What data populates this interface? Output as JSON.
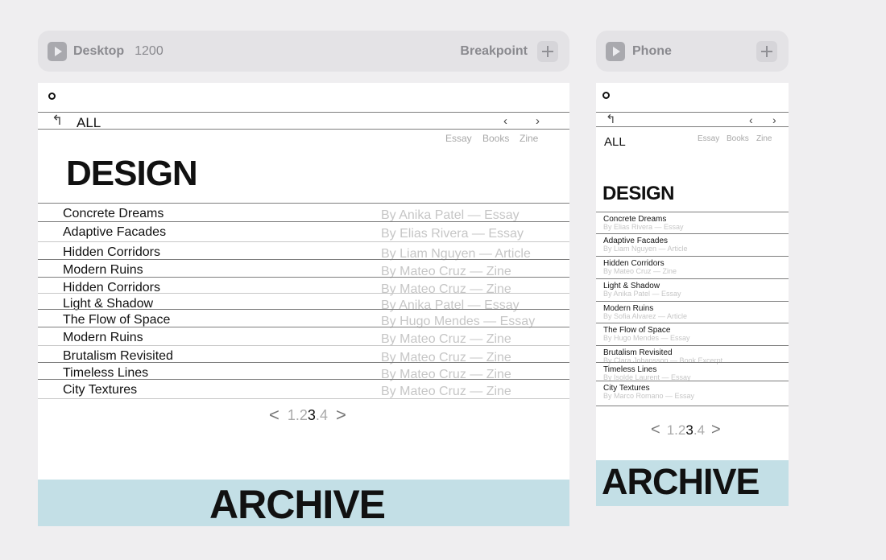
{
  "desktop_toolbar": {
    "label": "Desktop",
    "width_value": "1200",
    "breakpoint_label": "Breakpoint"
  },
  "phone_toolbar": {
    "label": "Phone"
  },
  "site": {
    "back_label": "ALL",
    "filters": [
      "Essay",
      "Books",
      "Zine"
    ],
    "heading": "DESIGN",
    "footer_title": "ARCHIVE",
    "pager": {
      "pages": [
        "1",
        "2",
        "3",
        "4"
      ],
      "current": "3"
    },
    "colors": {
      "band": "#c3dfe6",
      "meta_text": "#c6c6c6"
    }
  },
  "desktop_list": [
    {
      "title": "Concrete Dreams",
      "meta": "By Anika Patel — Essay"
    },
    {
      "title": "Adaptive Facades",
      "meta": "By Elias Rivera — Essay"
    },
    {
      "title": "Hidden Corridors",
      "meta": "By Liam Nguyen — Article"
    },
    {
      "title": "Modern Ruins",
      "meta": "By Mateo Cruz — Zine"
    },
    {
      "title": "Hidden Corridors",
      "meta": "By Mateo Cruz — Zine"
    },
    {
      "title": "Light & Shadow",
      "meta": "By Anika Patel — Essay"
    },
    {
      "title": "The Flow of Space",
      "meta": "By Hugo Mendes — Essay"
    },
    {
      "title": "Modern Ruins",
      "meta": "By Mateo Cruz — Zine"
    },
    {
      "title": "Brutalism Revisited",
      "meta": "By Mateo Cruz — Zine"
    },
    {
      "title": "Timeless Lines",
      "meta": "By Mateo Cruz — Zine"
    },
    {
      "title": "City Textures",
      "meta": "By Mateo Cruz — Zine"
    }
  ],
  "phone_list": [
    {
      "title": "Concrete Dreams",
      "meta": "By Elias Rivera — Essay"
    },
    {
      "title": "Adaptive Facades",
      "meta": "By Liam Nguyen — Article"
    },
    {
      "title": "Hidden Corridors",
      "meta": "By Mateo Cruz — Zine"
    },
    {
      "title": "Light & Shadow",
      "meta": "By Anika Patel — Essay"
    },
    {
      "title": "Modern Ruins",
      "meta": "By Sofia Alvarez — Article"
    },
    {
      "title": "The Flow of Space",
      "meta": "By Hugo Mendes — Essay"
    },
    {
      "title": "Brutalism Revisited",
      "meta": "By Clara Johansson — Book Excerpt"
    },
    {
      "title": "Timeless Lines",
      "meta": "By Isolde Laurent — Essay"
    },
    {
      "title": "City Textures",
      "meta": "By Marco Romano — Essay"
    }
  ]
}
